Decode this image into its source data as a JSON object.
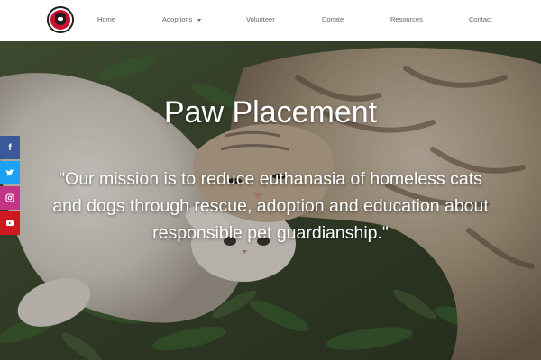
{
  "nav": {
    "items": [
      {
        "label": "Home"
      },
      {
        "label": "Adoptions"
      },
      {
        "label": "Volunteer"
      },
      {
        "label": "Donate"
      },
      {
        "label": "Resources"
      },
      {
        "label": "Contact"
      }
    ]
  },
  "hero": {
    "title": "Paw Placement",
    "quote": "\"Our mission is to reduce euthanasia of homeless cats and dogs through rescue, adoption and education about responsible pet guardianship.\""
  },
  "social": {
    "icons": [
      "facebook-icon",
      "twitter-icon",
      "instagram-icon",
      "youtube-icon"
    ]
  },
  "colors": {
    "facebook": "#3b5998",
    "twitter": "#1da1f2",
    "instagram": "#c13584",
    "youtube": "#cc181e"
  }
}
